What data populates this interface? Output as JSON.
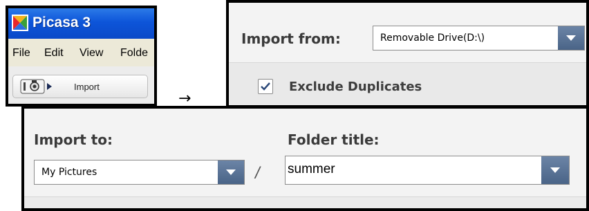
{
  "picasa_window": {
    "title": "Picasa 3",
    "menu": [
      {
        "label": "File"
      },
      {
        "label": "Edit"
      },
      {
        "label": "View"
      },
      {
        "label": "Folde"
      }
    ],
    "import_button_label": "Import"
  },
  "arrow_glyph": "→",
  "import_from": {
    "label": "Import from:",
    "selected_source": "Removable Drive(D:\\)",
    "exclude_duplicates": {
      "label": "Exclude Duplicates",
      "checked": true
    }
  },
  "import_to": {
    "label": "Import to:",
    "selected_destination": "My Pictures",
    "separator": "/",
    "folder_title_label": "Folder title:",
    "folder_title_value": "summer"
  },
  "icons": [
    "picasa-logo-icon",
    "camera-icon",
    "play-arrow-icon",
    "chevron-down-icon",
    "checkmark-icon"
  ],
  "colors": {
    "titlebar": "#0d55d9",
    "dropdown_button": "#4a6487",
    "panel_background": "#f3f3f3"
  }
}
